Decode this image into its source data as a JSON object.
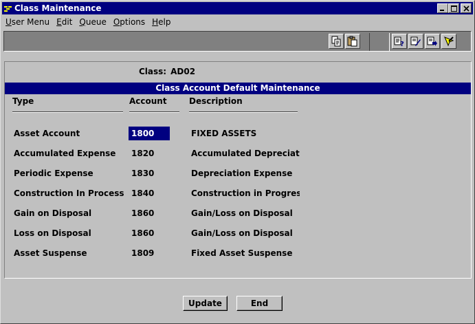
{
  "window": {
    "title": "Class Maintenance"
  },
  "menu": [
    {
      "label": "User Menu",
      "accel": "U",
      "rest": "ser Menu"
    },
    {
      "label": "Edit",
      "accel": "E",
      "rest": "dit"
    },
    {
      "label": "Queue",
      "accel": "Q",
      "rest": "ueue"
    },
    {
      "label": "Options",
      "accel": "O",
      "rest": "ptions"
    },
    {
      "label": "Help",
      "accel": "H",
      "rest": "elp"
    }
  ],
  "toolbar": {
    "buttons": [
      "copy-icon",
      "paste-icon",
      "query-icon",
      "query-edit-icon",
      "query-next-icon",
      "exit-icon"
    ]
  },
  "form": {
    "class_label": "Class:",
    "class_value": "AD02",
    "section_title": "Class Account Default Maintenance",
    "columns": {
      "type": "Type",
      "account": "Account",
      "description": "Description"
    },
    "rows": [
      {
        "type": "Asset Account",
        "account": "1800",
        "description": "FIXED ASSETS",
        "selected": true
      },
      {
        "type": "Accumulated Expense",
        "account": "1820",
        "description": "Accumulated Depreciation"
      },
      {
        "type": "Periodic Expense",
        "account": "1830",
        "description": "Depreciation Expense"
      },
      {
        "type": "Construction In Process",
        "account": "1840",
        "description": "Construction in Progress"
      },
      {
        "type": "Gain on Disposal",
        "account": "1860",
        "description": "Gain/Loss on Disposal"
      },
      {
        "type": "Loss on Disposal",
        "account": "1860",
        "description": "Gain/Loss on Disposal"
      },
      {
        "type": "Asset Suspense",
        "account": "1809",
        "description": "Fixed Asset Suspense"
      }
    ]
  },
  "buttons": {
    "update": "Update",
    "end": "End"
  },
  "colors": {
    "titlebar": "#000080",
    "face": "#c0c0c0",
    "selection": "#000080"
  }
}
